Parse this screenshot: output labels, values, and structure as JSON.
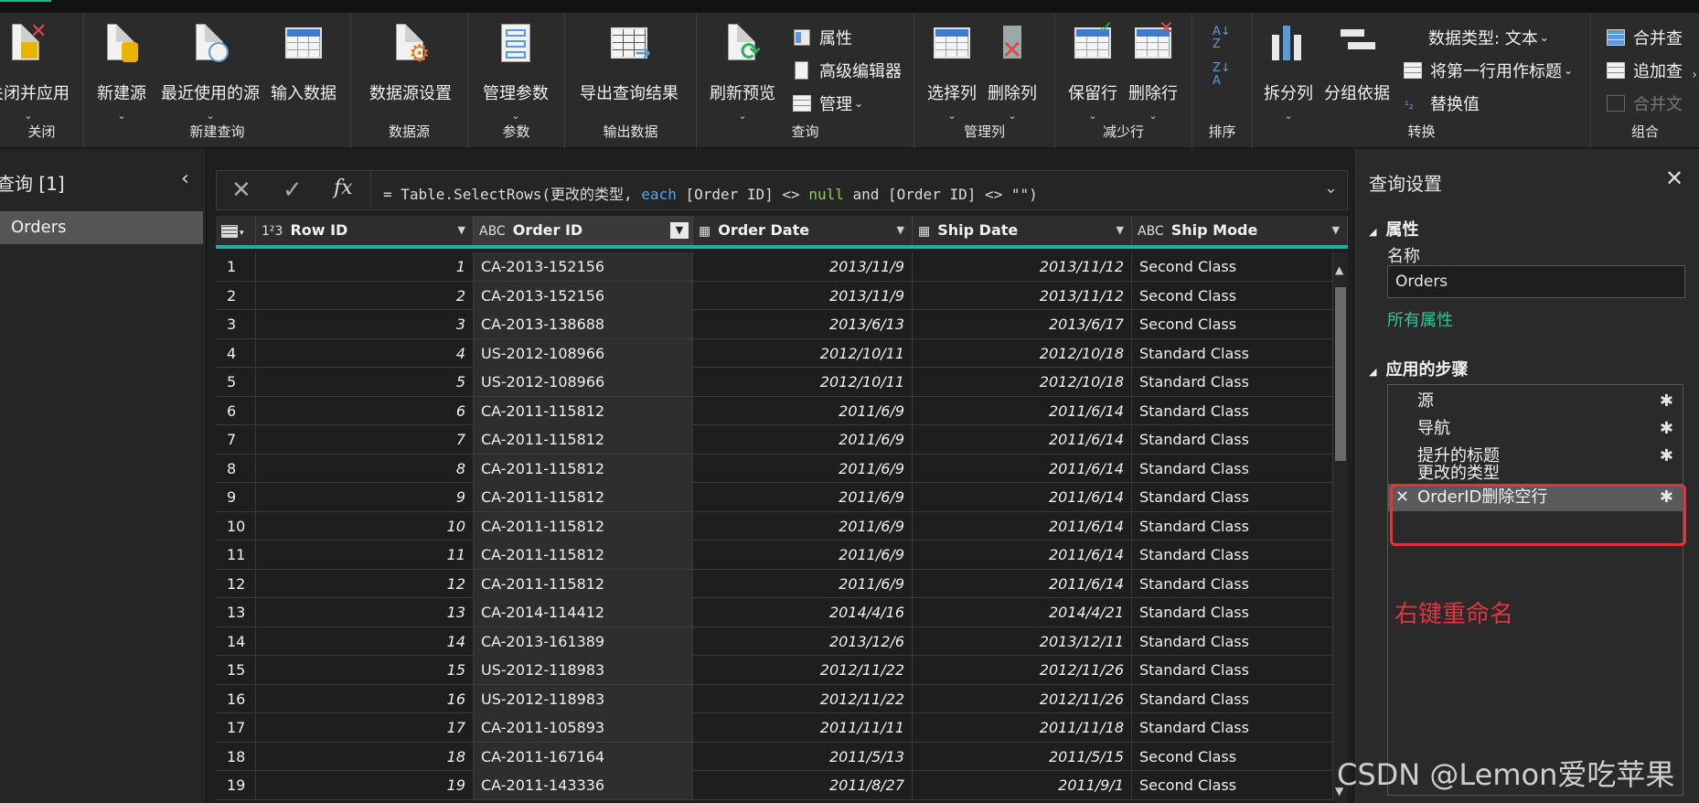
{
  "ribbon": {
    "groups": {
      "close": "关闭",
      "new_query": "新建查询",
      "data_source": "数据源",
      "params": "参数",
      "output": "输出数据",
      "query": "查询",
      "manage_cols": "管理列",
      "reduce_rows": "减少行",
      "sort": "排序",
      "transform": "转换",
      "combine": "组合"
    },
    "buttons": {
      "close_apply": "关闭并应用",
      "new_source": "新建源",
      "recent_sources": "最近使用的源",
      "enter_data": "输入数据",
      "data_source_settings": "数据源设置",
      "manage_params": "管理参数",
      "export_query": "导出查询结果",
      "refresh_preview": "刷新预览",
      "properties": "属性",
      "advanced_editor": "高级编辑器",
      "manage": "管理",
      "choose_columns": "选择列",
      "remove_columns": "删除列",
      "keep_rows": "保留行",
      "remove_rows": "删除行",
      "split_column": "拆分列",
      "group_by": "分组依据",
      "data_type": "数据类型: 文本",
      "first_row_header": "将第一行用作标题",
      "replace_values": "替换值",
      "merge": "合并查",
      "append": "追加查",
      "combine_files": "合并文"
    }
  },
  "left_pane": {
    "title": "查询 [1]",
    "items": [
      "Orders"
    ]
  },
  "formula_bar": {
    "prefix": "= Table.SelectRows(更改的类型, ",
    "kw_each": "each",
    "mid1": " [Order ID] <> ",
    "kw_null": "null",
    "mid2": " and [Order ID] <> \"\")"
  },
  "grid": {
    "columns": [
      {
        "type_icon": "1²3",
        "name": "Row ID"
      },
      {
        "type_icon": "ABC",
        "name": "Order ID"
      },
      {
        "type_icon": "▦",
        "name": "Order Date"
      },
      {
        "type_icon": "▦",
        "name": "Ship Date"
      },
      {
        "type_icon": "ABC",
        "name": "Ship Mode"
      }
    ],
    "rows": [
      [
        "1",
        "1",
        "CA-2013-152156",
        "2013/11/9",
        "2013/11/12",
        "Second Class"
      ],
      [
        "2",
        "2",
        "CA-2013-152156",
        "2013/11/9",
        "2013/11/12",
        "Second Class"
      ],
      [
        "3",
        "3",
        "CA-2013-138688",
        "2013/6/13",
        "2013/6/17",
        "Second Class"
      ],
      [
        "4",
        "4",
        "US-2012-108966",
        "2012/10/11",
        "2012/10/18",
        "Standard Class"
      ],
      [
        "5",
        "5",
        "US-2012-108966",
        "2012/10/11",
        "2012/10/18",
        "Standard Class"
      ],
      [
        "6",
        "6",
        "CA-2011-115812",
        "2011/6/9",
        "2011/6/14",
        "Standard Class"
      ],
      [
        "7",
        "7",
        "CA-2011-115812",
        "2011/6/9",
        "2011/6/14",
        "Standard Class"
      ],
      [
        "8",
        "8",
        "CA-2011-115812",
        "2011/6/9",
        "2011/6/14",
        "Standard Class"
      ],
      [
        "9",
        "9",
        "CA-2011-115812",
        "2011/6/9",
        "2011/6/14",
        "Standard Class"
      ],
      [
        "10",
        "10",
        "CA-2011-115812",
        "2011/6/9",
        "2011/6/14",
        "Standard Class"
      ],
      [
        "11",
        "11",
        "CA-2011-115812",
        "2011/6/9",
        "2011/6/14",
        "Standard Class"
      ],
      [
        "12",
        "12",
        "CA-2011-115812",
        "2011/6/9",
        "2011/6/14",
        "Standard Class"
      ],
      [
        "13",
        "13",
        "CA-2014-114412",
        "2014/4/16",
        "2014/4/21",
        "Standard Class"
      ],
      [
        "14",
        "14",
        "CA-2013-161389",
        "2013/12/6",
        "2013/12/11",
        "Standard Class"
      ],
      [
        "15",
        "15",
        "US-2012-118983",
        "2012/11/22",
        "2012/11/26",
        "Standard Class"
      ],
      [
        "16",
        "16",
        "US-2012-118983",
        "2012/11/22",
        "2012/11/26",
        "Standard Class"
      ],
      [
        "17",
        "17",
        "CA-2011-105893",
        "2011/11/11",
        "2011/11/18",
        "Standard Class"
      ],
      [
        "18",
        "18",
        "CA-2011-167164",
        "2011/5/13",
        "2011/5/15",
        "Second Class"
      ],
      [
        "19",
        "19",
        "CA-2011-143336",
        "2011/8/27",
        "2011/9/1",
        "Second Class"
      ]
    ]
  },
  "right_pane": {
    "title": "查询设置",
    "properties_heading": "属性",
    "name_label": "名称",
    "name_value": "Orders",
    "all_properties": "所有属性",
    "steps_heading": "应用的步骤",
    "steps": [
      "源",
      "导航",
      "提升的标题",
      "更改的类型",
      "OrderID删除空行"
    ]
  },
  "annotation": {
    "text": "右键重命名",
    "color": "#e0353f"
  },
  "watermark": "CSDN @Lemon爱吃苹果",
  "colors": {
    "accent_teal": "#1fb0a0",
    "link_green": "#2fc79a"
  }
}
